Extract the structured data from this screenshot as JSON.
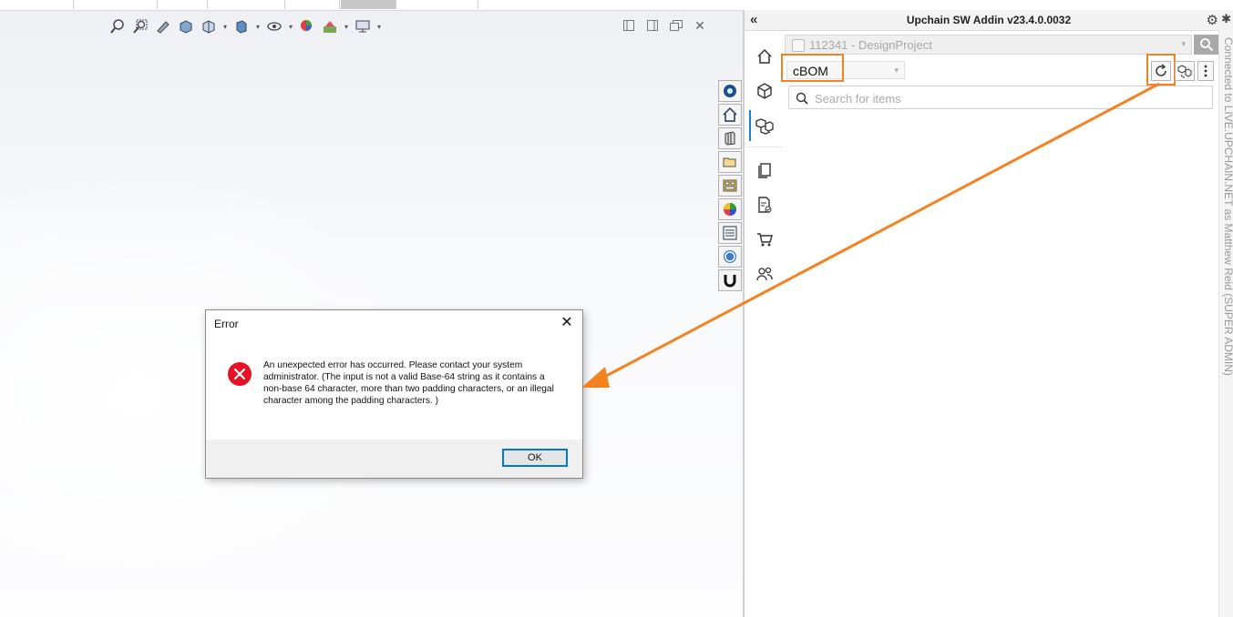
{
  "panel": {
    "title": "Upchain SW Addin v23.4.0.0032",
    "project": "112341 - DesignProject",
    "bom_view": "cBOM",
    "search_placeholder": "Search for items",
    "connection": "Connected to LIVE.UPCHAIN.NET as Matthew Reid (SUPER ADMIN)"
  },
  "dialog": {
    "title": "Error",
    "message": "An unexpected error has occurred. Please contact your system administrator. (The input is not a valid Base-64 string as it contains a non-base 64 character, more than two padding characters, or an illegal character among the padding characters. )",
    "ok_label": "OK"
  },
  "toolbar_icons": [
    "zoom-to-fit-icon",
    "zoom-to-area-icon",
    "previous-view-icon",
    "section-view-icon",
    "view-orientation-icon",
    "display-style-icon",
    "hide-show-icon",
    "edit-appearance-icon",
    "apply-scene-icon",
    "view-settings-icon"
  ],
  "rail_icons": [
    "home-icon",
    "part-cube-icon",
    "assembly-icon",
    "documents-icon",
    "approvals-icon",
    "cart-icon",
    "users-icon"
  ],
  "colors": {
    "highlight": "#f58220",
    "error": "#e81123",
    "accent": "#0078d7"
  }
}
